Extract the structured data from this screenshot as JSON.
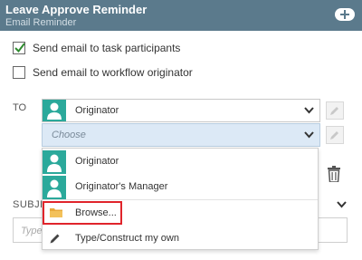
{
  "header": {
    "title": "Leave Approve Reminder",
    "subtitle": "Email Reminder"
  },
  "options": {
    "send_participants": {
      "label": "Send email to task participants",
      "checked": true
    },
    "send_originator": {
      "label": "Send email to workflow originator",
      "checked": false
    }
  },
  "to": {
    "label": "TO",
    "selected_value": "Originator",
    "choose_placeholder": "Choose"
  },
  "dropdown": {
    "items": [
      {
        "label": "Originator",
        "icon": "user-icon"
      },
      {
        "label": "Originator's Manager",
        "icon": "user-icon"
      },
      {
        "label": "Browse...",
        "icon": "folder-icon"
      },
      {
        "label": "Type/Construct my own",
        "icon": "pencil-icon"
      }
    ]
  },
  "subject": {
    "label": "SUBJE",
    "placeholder": "Type"
  },
  "colors": {
    "header_bg": "#5b7a8c",
    "avatar": "#2ba99b",
    "choose_bg": "#dce9f6",
    "highlight": "#e0242b",
    "checkmark": "#2e8b2e"
  }
}
